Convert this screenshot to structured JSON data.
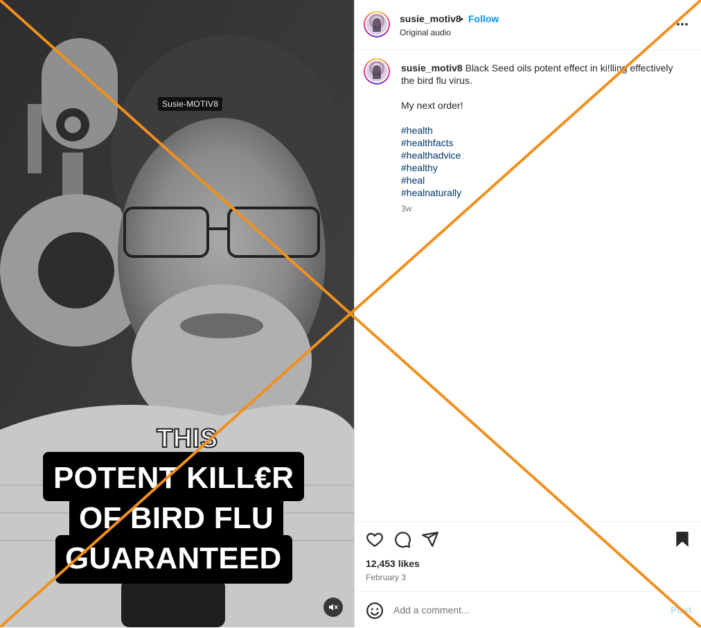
{
  "video": {
    "watermark": "Susie-MOTIV8",
    "caption_small": "THIS",
    "caption_lines": [
      "POTENT KILL€R",
      "OF BIRD FLU",
      "GUARANTEED"
    ],
    "mute_icon": "speaker-muted-icon"
  },
  "header": {
    "username": "susie_motiv8",
    "separator": "•",
    "follow_label": "Follow",
    "audio_label": "Original audio",
    "more_icon": "more-horizontal-icon"
  },
  "caption": {
    "username": "susie_motiv8",
    "text": "Black Seed oils potent effect in ki!lling effectively the bird flu virus.",
    "line2": "My next order!",
    "hashtags": [
      "#health",
      "#healthfacts",
      "#healthadvice",
      "#healthy",
      "#heal",
      "#healnaturally"
    ],
    "time": "3w"
  },
  "actions": {
    "icons": [
      "heart-icon",
      "comment-icon",
      "share-icon",
      "bookmark-icon"
    ],
    "likes": "12,453 likes",
    "date": "February 3"
  },
  "comment": {
    "placeholder": "Add a comment...",
    "post_label": "Post",
    "emoji_icon": "emoji-icon"
  },
  "colors": {
    "accent": "#0095f6",
    "hashtag": "#00376b",
    "overlay_x": "#f0901e",
    "caption_bg": "#000000"
  }
}
